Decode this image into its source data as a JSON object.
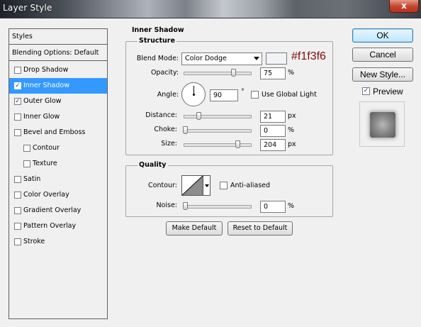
{
  "window": {
    "title": "Layer Style",
    "close_label": "x"
  },
  "styles_list": {
    "header": "Styles",
    "blending": "Blending Options: Default",
    "items": [
      {
        "label": "Drop Shadow",
        "checked": false,
        "selected": false
      },
      {
        "label": "Inner Shadow",
        "checked": true,
        "selected": true
      },
      {
        "label": "Outer Glow",
        "checked": true,
        "selected": false
      },
      {
        "label": "Inner Glow",
        "checked": false,
        "selected": false
      },
      {
        "label": "Bevel and Emboss",
        "checked": false,
        "selected": false
      },
      {
        "label": "Contour",
        "checked": false,
        "selected": false,
        "sub": true
      },
      {
        "label": "Texture",
        "checked": false,
        "selected": false,
        "sub": true
      },
      {
        "label": "Satin",
        "checked": false,
        "selected": false
      },
      {
        "label": "Color Overlay",
        "checked": false,
        "selected": false
      },
      {
        "label": "Gradient Overlay",
        "checked": false,
        "selected": false
      },
      {
        "label": "Pattern Overlay",
        "checked": false,
        "selected": false
      },
      {
        "label": "Stroke",
        "checked": false,
        "selected": false
      }
    ]
  },
  "inner_shadow": {
    "title": "Inner Shadow",
    "structure": {
      "title": "Structure",
      "blend_mode_label": "Blend Mode:",
      "blend_mode_value": "Color Dodge",
      "color_hex_note": "#f1f3f6",
      "swatch_color": "#f1f3f6",
      "opacity_label": "Opacity:",
      "opacity_value": "75",
      "opacity_unit": "%",
      "opacity_fraction": 0.75,
      "angle_label": "Angle:",
      "angle_value": "90",
      "angle_unit": "°",
      "global_light_label": "Use Global Light",
      "global_light_checked": false,
      "distance_label": "Distance:",
      "distance_value": "21",
      "distance_unit": "px",
      "distance_fraction": 0.21,
      "choke_label": "Choke:",
      "choke_value": "0",
      "choke_unit": "%",
      "choke_fraction": 0.0,
      "size_label": "Size:",
      "size_value": "204",
      "size_unit": "px",
      "size_fraction": 0.82
    },
    "quality": {
      "title": "Quality",
      "contour_label": "Contour:",
      "anti_aliased_label": "Anti-aliased",
      "anti_aliased_checked": false,
      "noise_label": "Noise:",
      "noise_value": "0",
      "noise_unit": "%",
      "noise_fraction": 0.0
    },
    "make_default_label": "Make Default",
    "reset_default_label": "Reset to Default"
  },
  "actions": {
    "ok_label": "OK",
    "cancel_label": "Cancel",
    "new_style_label": "New Style...",
    "preview_label": "Preview",
    "preview_checked": true
  }
}
